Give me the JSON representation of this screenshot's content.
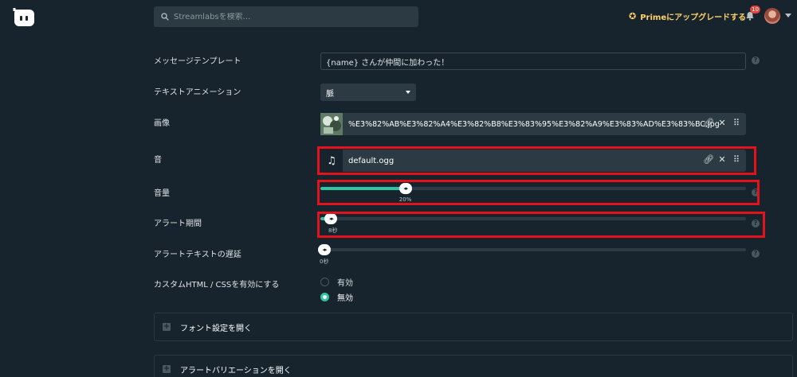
{
  "header": {
    "search_placeholder": "Streamlabsを検索...",
    "prime_label": "Primeにアップグレードする",
    "notification_count": "10"
  },
  "form": {
    "message_template": {
      "label": "メッセージテンプレート",
      "value": "{name} さんが仲間に加わった！"
    },
    "text_animation": {
      "label": "テキストアニメーション",
      "value": "脈"
    },
    "image": {
      "label": "画像",
      "filename": "%E3%82%AB%E3%82%A4%E3%82%B8%E3%83%95%E3%82%A9%E3%83%AD%E3%83%BC.jpg"
    },
    "sound": {
      "label": "音",
      "filename": "default.ogg"
    },
    "volume": {
      "label": "音量",
      "value_text": "20%",
      "value": 20
    },
    "alert_duration": {
      "label": "アラート期間",
      "value_text": "8秒",
      "fraction": 0.025
    },
    "text_delay": {
      "label": "アラートテキストの遅延",
      "value_text": "0秒",
      "fraction": 0
    },
    "custom_css": {
      "label": "カスタムHTML / CSSを有効にする",
      "options": [
        "有効",
        "無効"
      ],
      "selected": "無効"
    }
  },
  "sections": {
    "font": "フォント設定を開く",
    "variation": "アラートバリエーションを開く"
  },
  "colors": {
    "accent": "#31c3a2",
    "highlight": "#e3131b",
    "prime": "#ffd166",
    "background": "#17242d"
  }
}
